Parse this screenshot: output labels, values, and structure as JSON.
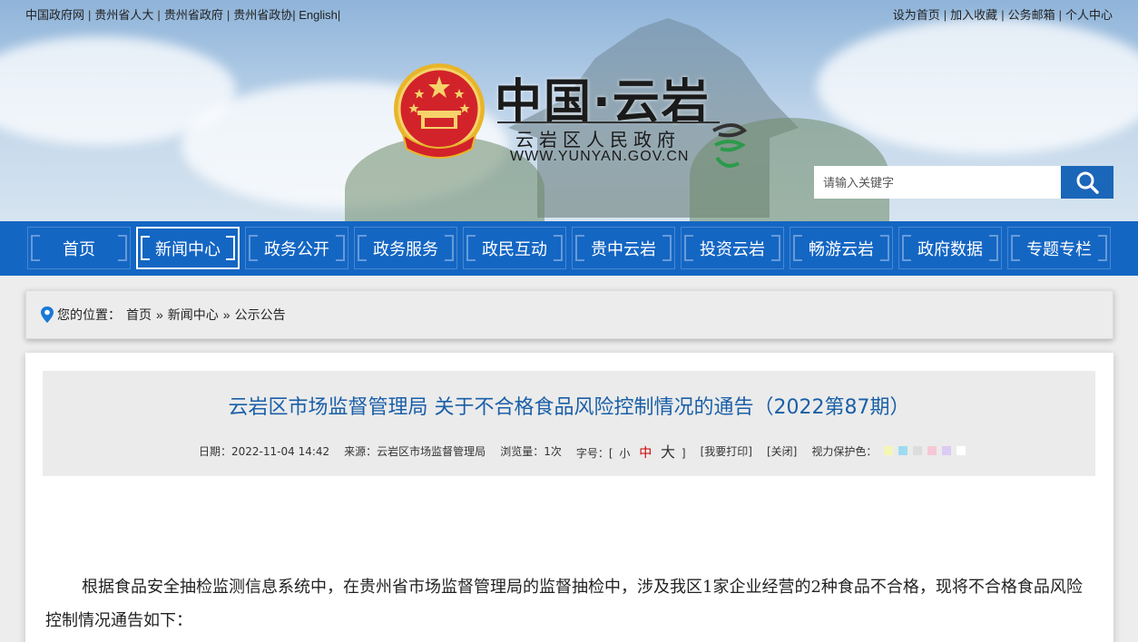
{
  "top_links_left": [
    "中国政府网",
    "贵州省人大",
    "贵州省政府",
    "贵州省政协",
    "English"
  ],
  "top_links_right": [
    "设为首页",
    "加入收藏",
    "公务邮箱",
    "个人中心"
  ],
  "logo": {
    "title": "中国·云岩",
    "subtitle": "云岩区人民政府",
    "url": "WWW.YUNYAN.GOV.CN"
  },
  "search": {
    "placeholder": "请输入关键字"
  },
  "nav": {
    "items": [
      "首页",
      "新闻中心",
      "政务公开",
      "政务服务",
      "政民互动",
      "贵中云岩",
      "投资云岩",
      "畅游云岩",
      "政府数据",
      "专题专栏"
    ],
    "active_index": 1
  },
  "breadcrumb": {
    "label": "您的位置：",
    "items": [
      "首页",
      "新闻中心",
      "公示公告"
    ],
    "separator": "»"
  },
  "article": {
    "title": "云岩区市场监督管理局 关于不合格食品风险控制情况的通告（2022第87期）",
    "date_label": "日期：",
    "date": "2022-11-04 14:42",
    "source_label": "来源：",
    "source": "云岩区市场监督管理局",
    "views_label": "浏览量：",
    "views": "1次",
    "font_label": "字号：",
    "font_open": "[",
    "font_small": "小",
    "font_mid": "中",
    "font_big": "大",
    "font_close": "]",
    "print": "[我要打印]",
    "close": "[关闭]",
    "eye_label": "视力保护色：",
    "eye_colors": [
      "#f5f5b5",
      "#9fdbf0",
      "#dcdcdc",
      "#f6c7d6",
      "#dccbf2",
      "#ffffff"
    ],
    "body": "根据食品安全抽检监测信息系统中，在贵州省市场监督管理局的监督抽检中，涉及我区1家企业经营的2种食品不合格，现将不合格食品风险控制情况通告如下："
  },
  "colors": {
    "nav_blue": "#1466c3",
    "title_blue": "#1a5fa8",
    "search_btn": "#1a66b8"
  }
}
